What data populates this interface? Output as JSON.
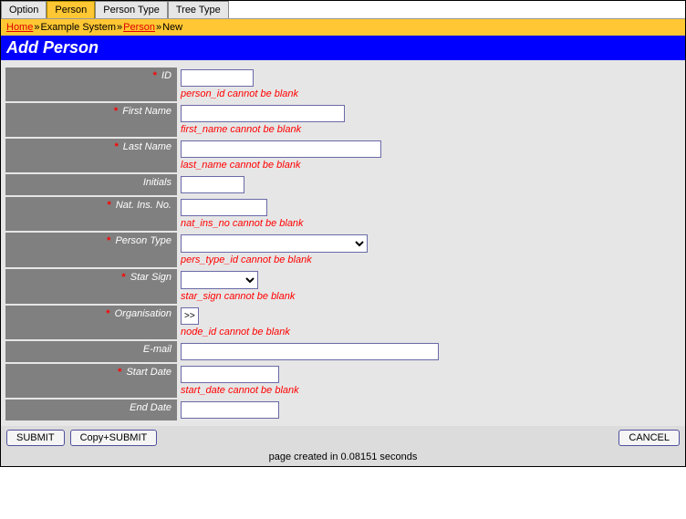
{
  "tabs": {
    "option": "Option",
    "person": "Person",
    "person_type": "Person Type",
    "tree_type": "Tree Type"
  },
  "breadcrumb": {
    "home": "Home",
    "system": "Example System",
    "person": "Person",
    "current": "New",
    "sep": "»"
  },
  "title": "Add Person",
  "fields": {
    "id": {
      "label": "ID",
      "required": true,
      "error": "person_id cannot be blank"
    },
    "first_name": {
      "label": "First Name",
      "required": true,
      "error": "first_name cannot be blank"
    },
    "last_name": {
      "label": "Last Name",
      "required": true,
      "error": "last_name cannot be blank"
    },
    "initials": {
      "label": "Initials",
      "required": false,
      "error": ""
    },
    "nat_ins_no": {
      "label": "Nat. Ins. No.",
      "required": true,
      "error": "nat_ins_no cannot be blank"
    },
    "person_type": {
      "label": "Person Type",
      "required": true,
      "error": "pers_type_id cannot be blank"
    },
    "star_sign": {
      "label": "Star Sign",
      "required": true,
      "error": "star_sign cannot be blank"
    },
    "organisation": {
      "label": "Organisation",
      "required": true,
      "error": "node_id cannot be blank",
      "popup": ">>"
    },
    "email": {
      "label": "E-mail",
      "required": false,
      "error": ""
    },
    "start_date": {
      "label": "Start Date",
      "required": true,
      "error": "start_date cannot be blank"
    },
    "end_date": {
      "label": "End Date",
      "required": false,
      "error": ""
    }
  },
  "required_marker": "*",
  "buttons": {
    "submit": "SUBMIT",
    "copy_submit": "Copy+SUBMIT",
    "cancel": "CANCEL"
  },
  "footer": "page created in 0.08151 seconds"
}
